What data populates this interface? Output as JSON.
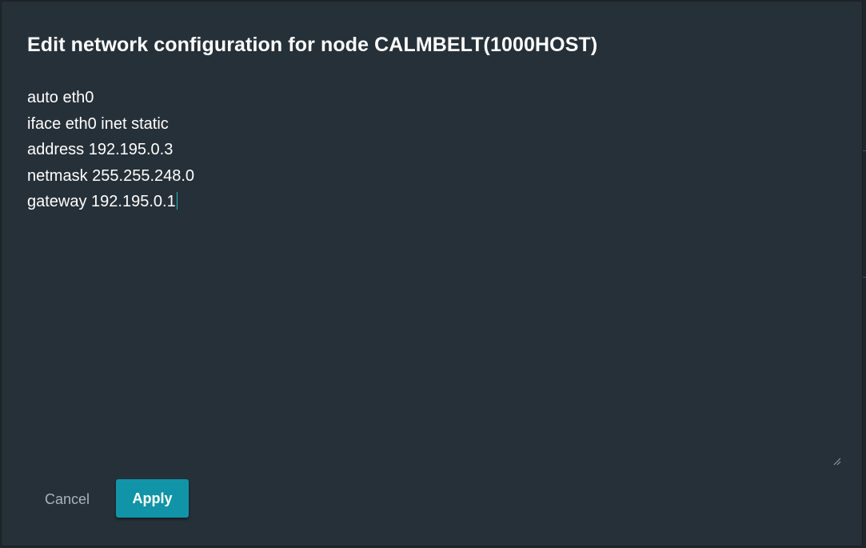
{
  "dialog": {
    "title": "Edit network configuration for node CALMBELT(1000HOST)",
    "config_lines": [
      "auto eth0",
      "iface eth0 inet static",
      "address 192.195.0.3",
      "netmask 255.255.248.0",
      "gateway 192.195.0.1"
    ],
    "cancel_label": "Cancel",
    "apply_label": "Apply"
  },
  "colors": {
    "dialog_background": "#263038",
    "accent": "#1194a7",
    "cancel_text": "#a8b3bc",
    "caret": "#2bb3c3"
  },
  "icons": {
    "resize": "textarea-resize-grip-icon"
  }
}
